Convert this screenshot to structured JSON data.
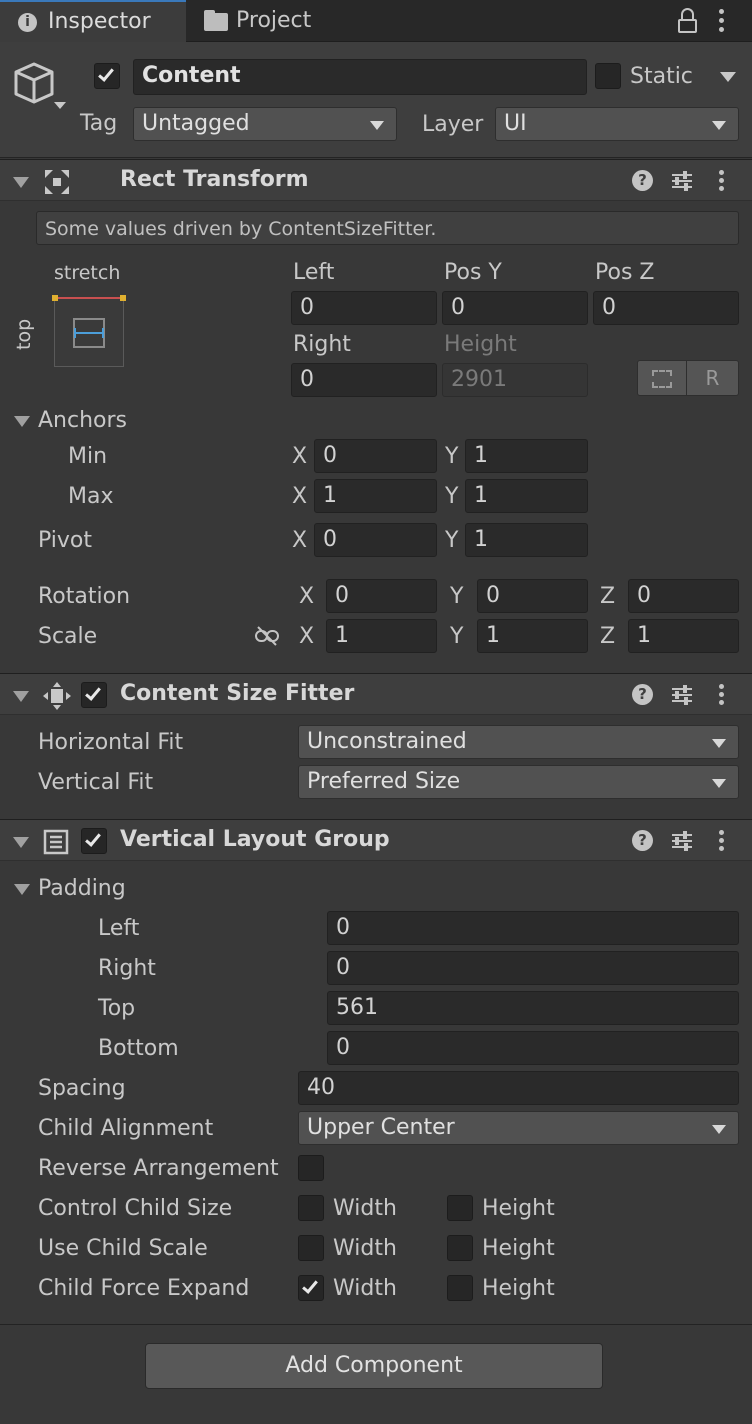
{
  "tabs": {
    "inspector": "Inspector",
    "project": "Project"
  },
  "object": {
    "name": "Content",
    "active": true,
    "static_label": "Static",
    "static": false,
    "tag_label": "Tag",
    "tag": "Untagged",
    "layer_label": "Layer",
    "layer": "UI"
  },
  "rect_transform": {
    "title": "Rect Transform",
    "info": "Some values driven by ContentSizeFitter.",
    "anchor_preset_h": "stretch",
    "anchor_preset_v": "top",
    "left_label": "Left",
    "left": "0",
    "posy_label": "Pos Y",
    "posy": "0",
    "posz_label": "Pos Z",
    "posz": "0",
    "right_label": "Right",
    "right": "0",
    "height_label": "Height",
    "height": "2901",
    "r_button": "R",
    "anchors_label": "Anchors",
    "min_label": "Min",
    "min_x": "0",
    "min_y": "1",
    "max_label": "Max",
    "max_x": "1",
    "max_y": "1",
    "pivot_label": "Pivot",
    "pivot_x": "0",
    "pivot_y": "1",
    "rotation_label": "Rotation",
    "rot_x": "0",
    "rot_y": "0",
    "rot_z": "0",
    "scale_label": "Scale",
    "scale_x": "1",
    "scale_y": "1",
    "scale_z": "1",
    "x": "X",
    "y": "Y",
    "z": "Z"
  },
  "content_size_fitter": {
    "title": "Content Size Fitter",
    "enabled": true,
    "hfit_label": "Horizontal Fit",
    "hfit": "Unconstrained",
    "vfit_label": "Vertical Fit",
    "vfit": "Preferred Size"
  },
  "vertical_layout_group": {
    "title": "Vertical Layout Group",
    "enabled": true,
    "padding_label": "Padding",
    "pad_left_label": "Left",
    "pad_left": "0",
    "pad_right_label": "Right",
    "pad_right": "0",
    "pad_top_label": "Top",
    "pad_top": "561",
    "pad_bottom_label": "Bottom",
    "pad_bottom": "0",
    "spacing_label": "Spacing",
    "spacing": "40",
    "align_label": "Child Alignment",
    "align": "Upper Center",
    "reverse_label": "Reverse Arrangement",
    "ccs_label": "Control Child Size",
    "ucs_label": "Use Child Scale",
    "cfe_label": "Child Force Expand",
    "width": "Width",
    "height": "Height"
  },
  "add_component": "Add Component",
  "colors": {
    "bg": "#383838",
    "header": "#3e3e3e",
    "field": "#2a2a2a",
    "accent": "#4c9ed9"
  }
}
